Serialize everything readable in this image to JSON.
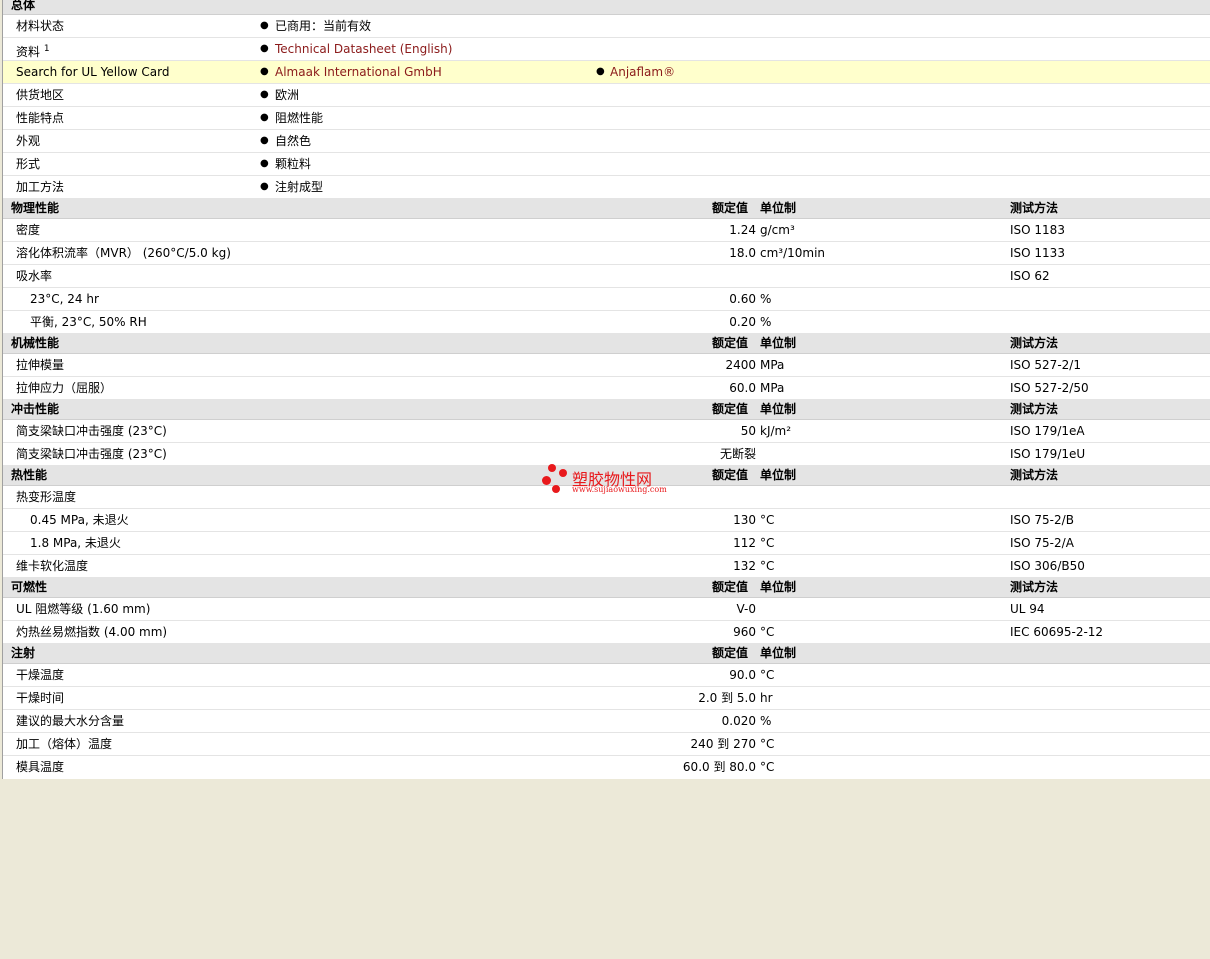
{
  "general": {
    "heading": "总体",
    "rows": [
      {
        "label": "材料状态",
        "value": "已商用：当前有效"
      },
      {
        "label": "资料",
        "sup": "1",
        "value": "Technical Datasheet (English)"
      },
      {
        "label": "Search for UL Yellow Card",
        "value": "Almaak International GmbH",
        "value2": "Anjaflam®"
      },
      {
        "label": "供货地区",
        "value": "欧洲"
      },
      {
        "label": "性能特点",
        "value": "阻燃性能"
      },
      {
        "label": "外观",
        "value": "自然色"
      },
      {
        "label": "形式",
        "value": "颗粒料"
      },
      {
        "label": "加工方法",
        "value": "注射成型"
      }
    ]
  },
  "columns": {
    "value": "额定值",
    "unit": "单位制",
    "test": "测试方法"
  },
  "sections": {
    "physical": {
      "heading": "物理性能",
      "rows": [
        {
          "label": "密度",
          "value": "1.24",
          "unit": "g/cm³",
          "test": "ISO 1183"
        },
        {
          "label": "溶化体积流率（MVR） (260°C/5.0 kg)",
          "value": "18.0",
          "unit": "cm³/10min",
          "test": "ISO 1133"
        },
        {
          "label": "吸水率",
          "value": "",
          "unit": "",
          "test": "ISO 62"
        },
        {
          "label": "23°C, 24 hr",
          "value": "0.60",
          "unit": "%",
          "test": ""
        },
        {
          "label": "平衡, 23°C, 50% RH",
          "value": "0.20",
          "unit": "%",
          "test": ""
        }
      ]
    },
    "mechanical": {
      "heading": "机械性能",
      "rows": [
        {
          "label": "拉伸模量",
          "value": "2400",
          "unit": "MPa",
          "test": "ISO 527-2/1"
        },
        {
          "label": "拉伸应力（屈服）",
          "value": "60.0",
          "unit": "MPa",
          "test": "ISO 527-2/50"
        }
      ]
    },
    "impact": {
      "heading": "冲击性能",
      "rows": [
        {
          "label": "简支梁缺口冲击强度 (23°C)",
          "value": "50",
          "unit": "kJ/m²",
          "test": "ISO 179/1eA"
        },
        {
          "label": "简支梁缺口冲击强度 (23°C)",
          "value": "无断裂",
          "unit": "",
          "test": "ISO 179/1eU"
        }
      ]
    },
    "thermal": {
      "heading": "热性能",
      "rows": [
        {
          "label": "热变形温度",
          "value": "",
          "unit": "",
          "test": ""
        },
        {
          "label": "0.45 MPa, 未退火",
          "value": "130",
          "unit": "°C",
          "test": "ISO 75-2/B"
        },
        {
          "label": "1.8 MPa, 未退火",
          "value": "112",
          "unit": "°C",
          "test": "ISO 75-2/A"
        },
        {
          "label": "维卡软化温度",
          "value": "132",
          "unit": "°C",
          "test": "ISO 306/B50"
        }
      ]
    },
    "flammability": {
      "heading": "可燃性",
      "rows": [
        {
          "label": "UL 阻燃等级 (1.60 mm)",
          "value": "V-0",
          "unit": "",
          "test": "UL 94"
        },
        {
          "label": "灼热丝易燃指数 (4.00 mm)",
          "value": "960",
          "unit": "°C",
          "test": "IEC 60695-2-12"
        }
      ]
    },
    "injection": {
      "heading": "注射",
      "rows": [
        {
          "label": "干燥温度",
          "value": "90.0",
          "unit": "°C"
        },
        {
          "label": "干燥时间",
          "value": "2.0 到  5.0",
          "unit": "hr"
        },
        {
          "label": "建议的最大水分含量",
          "value": "0.020",
          "unit": "%"
        },
        {
          "label": "加工（熔体）温度",
          "value": "240 到  270",
          "unit": "°C"
        },
        {
          "label": "模具温度",
          "value": "60.0 到  80.0",
          "unit": "°C"
        }
      ]
    }
  },
  "watermark": {
    "title": "塑胶物性网",
    "url": "www.sujiaowuxing.com"
  }
}
